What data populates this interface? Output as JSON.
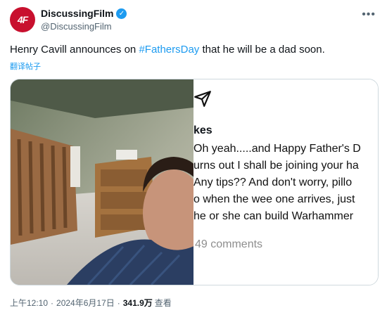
{
  "account": {
    "avatar_text": "4F",
    "display_name": "DiscussingFilm",
    "verified_mark": "✓",
    "handle": "@DiscussingFilm",
    "more_icon": "•••"
  },
  "tweet": {
    "text_before": "Henry Cavill announces on ",
    "hashtag": "#FathersDay",
    "text_after": " that he will be a dad soon.",
    "translate_label": "翻译帖子"
  },
  "embed": {
    "name_fragment": "kes",
    "lines": [
      "Oh yeah.....and Happy Father's D",
      "urns out I shall be joining your ha",
      "Any tips?? And don't worry, pillo",
      "o when the wee one arrives, just",
      "he or she can build Warhammer"
    ],
    "comments": "49 comments"
  },
  "meta": {
    "time": "上午12:10",
    "dot1": "·",
    "date": "2024年6月17日",
    "dot2": "·",
    "views": "341.9万",
    "views_label": "查看"
  }
}
